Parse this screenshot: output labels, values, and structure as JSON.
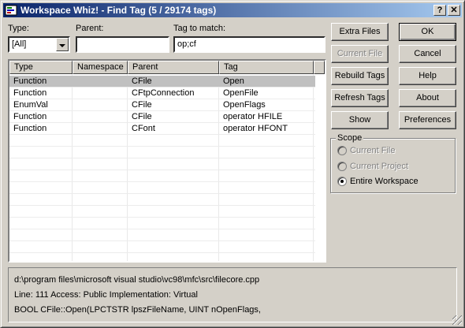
{
  "window": {
    "title": "Workspace Whiz! - Find Tag (5 / 29174 tags)",
    "help_btn": "?",
    "close_btn": "✕"
  },
  "filters": {
    "type_label": "Type:",
    "type_value": "[All]",
    "parent_label": "Parent:",
    "parent_value": "",
    "tag_label": "Tag to match:",
    "tag_value": "op;cf"
  },
  "list": {
    "columns": [
      "Type",
      "Namespace",
      "Parent",
      "Tag"
    ],
    "rows": [
      {
        "type": "Function",
        "namespace": "",
        "parent": "CFile",
        "tag": "Open"
      },
      {
        "type": "Function",
        "namespace": "",
        "parent": "CFtpConnection",
        "tag": "OpenFile"
      },
      {
        "type": "EnumVal",
        "namespace": "",
        "parent": "CFile",
        "tag": "OpenFlags"
      },
      {
        "type": "Function",
        "namespace": "",
        "parent": "CFile",
        "tag": "operator HFILE"
      },
      {
        "type": "Function",
        "namespace": "",
        "parent": "CFont",
        "tag": "operator HFONT"
      }
    ],
    "selected_index": 0
  },
  "buttons": {
    "extra_files": "Extra Files",
    "current_file": "Current File",
    "rebuild_tags": "Rebuild Tags",
    "refresh_tags": "Refresh Tags",
    "show": "Show",
    "ok": "OK",
    "cancel": "Cancel",
    "help": "Help",
    "about": "About",
    "preferences": "Preferences"
  },
  "scope": {
    "title": "Scope",
    "options": [
      "Current File",
      "Current Project",
      "Entire Workspace"
    ],
    "selected": "Entire Workspace"
  },
  "info": {
    "path": "d:\\program files\\microsoft visual studio\\vc98\\mfc\\src\\filecore.cpp",
    "line": "Line: 111     Access: Public  Implementation: Virtual",
    "signature": "BOOL CFile::Open(LPCTSTR lpszFileName, UINT nOpenFlags,"
  },
  "colors": {
    "titlebar_start": "#0a246a",
    "titlebar_end": "#a6caf0",
    "face": "#d4d0c8",
    "selection": "#c0c0c0"
  }
}
